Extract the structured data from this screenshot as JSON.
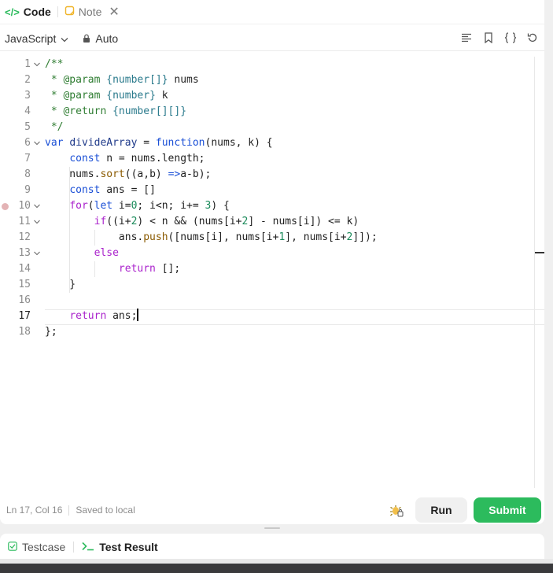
{
  "tabs": {
    "code_label": "Code",
    "note_label": "Note",
    "close_symbol": "✕"
  },
  "toolbar": {
    "language": "JavaScript",
    "mode": "Auto"
  },
  "editor": {
    "current_line": 17,
    "breakpoint_line": 10,
    "lines": [
      {
        "n": "1",
        "fold": true
      },
      {
        "n": "2",
        "fold": false
      },
      {
        "n": "3",
        "fold": false
      },
      {
        "n": "4",
        "fold": false
      },
      {
        "n": "5",
        "fold": false
      },
      {
        "n": "6",
        "fold": true
      },
      {
        "n": "7",
        "fold": false
      },
      {
        "n": "8",
        "fold": false
      },
      {
        "n": "9",
        "fold": false
      },
      {
        "n": "10",
        "fold": true
      },
      {
        "n": "11",
        "fold": true
      },
      {
        "n": "12",
        "fold": false
      },
      {
        "n": "13",
        "fold": true
      },
      {
        "n": "14",
        "fold": false
      },
      {
        "n": "15",
        "fold": false
      },
      {
        "n": "16",
        "fold": false
      },
      {
        "n": "17",
        "fold": false
      },
      {
        "n": "18",
        "fold": false
      }
    ]
  },
  "status": {
    "position": "Ln 17, Col 16",
    "saved": "Saved to local"
  },
  "actions": {
    "run_label": "Run",
    "submit_label": "Submit"
  },
  "bottom_tabs": {
    "testcase_label": "Testcase",
    "result_label": "Test Result"
  },
  "colors": {
    "submit": "#2cbb5d",
    "code_icon": "#2cbb5d",
    "note_icon": "#f0b429",
    "breakpoint": "#e3b3b5"
  }
}
